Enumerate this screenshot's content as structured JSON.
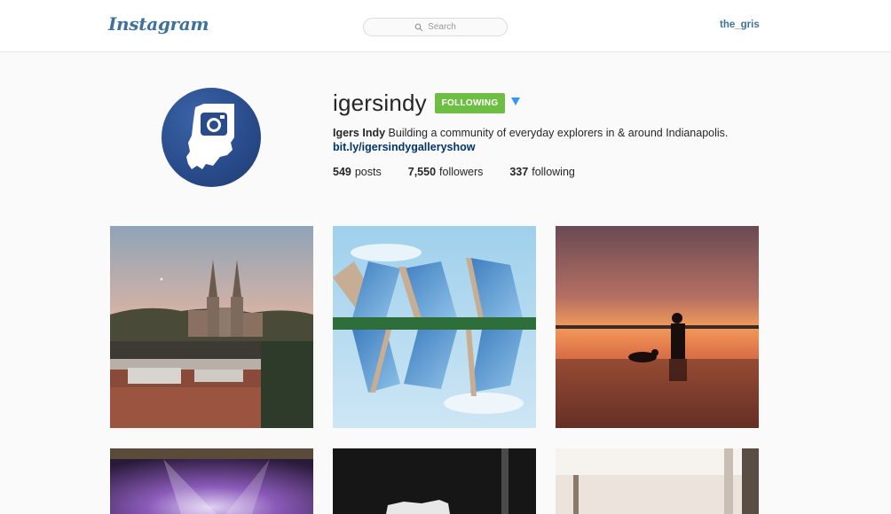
{
  "header": {
    "logo_text": "Instagram",
    "search_placeholder": "Search",
    "username": "the_gris"
  },
  "profile": {
    "username": "igersindy",
    "follow_button": "FOLLOWING",
    "full_name": "Igers Indy",
    "bio": "Building a community of everyday explorers in & around Indianapolis.",
    "link": "bit.ly/igersindygalleryshow",
    "stats": {
      "posts_count": "549",
      "posts_label": "posts",
      "followers_count": "7,550",
      "followers_label": "followers",
      "following_count": "337",
      "following_label": "following"
    }
  },
  "colors": {
    "brand": "#3f729b",
    "follow_green": "#6fbe44",
    "link": "#003569",
    "arrow": "#3897f0"
  },
  "icons": [
    "search-icon",
    "chevron-down-icon"
  ],
  "photos": [
    "photo-cathedral-sunset",
    "photo-reflected-buildings",
    "photo-lake-sunset-dog",
    "photo-stage-lights",
    "photo-dark-object",
    "photo-white-interior"
  ]
}
